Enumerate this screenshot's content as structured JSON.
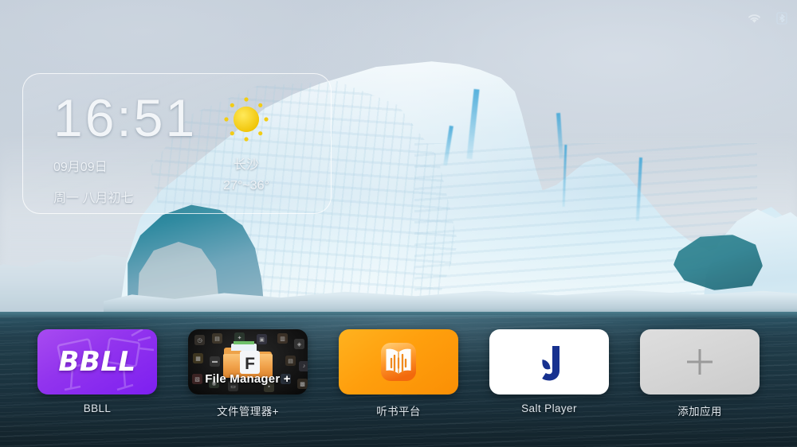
{
  "status_bar": {
    "icons": [
      {
        "name": "wifi-icon",
        "label": "wifi"
      },
      {
        "name": "bluetooth-icon",
        "label": "bluetooth"
      }
    ]
  },
  "widget": {
    "time": "16:51",
    "date": "09月09日",
    "weekday_lunar": "周一  八月初七",
    "weather_icon": "sunny-icon",
    "city": "长沙",
    "temperature_range": "27°~36°"
  },
  "dock": {
    "apps": [
      {
        "label": "BBLL",
        "icon": "bbll-icon",
        "tile_text": "BBLL",
        "color": "#9234ee"
      },
      {
        "label": "文件管理器+",
        "icon": "file-manager-icon",
        "tile_text": "File Manager +",
        "color": "#151515"
      },
      {
        "label": "听书平台",
        "icon": "audiobook-icon",
        "tile_text": "",
        "color": "#ff9f0d"
      },
      {
        "label": "Salt Player",
        "icon": "salt-player-icon",
        "tile_text": "J",
        "color": "#17318f"
      },
      {
        "label": "添加应用",
        "icon": "plus-icon",
        "tile_text": "+",
        "color": "#d4d4d4"
      }
    ]
  },
  "theme": {
    "sky": "#ccd5de",
    "ice": "#e6f2f8",
    "sea": "#1b333f",
    "label_text": "#dfe6ec"
  }
}
